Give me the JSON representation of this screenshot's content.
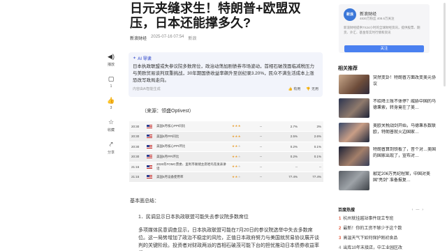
{
  "article": {
    "title": "日元夹缝求生！特朗普+欧盟双压，日本还能撑多久?",
    "source": "新浪财经",
    "datetime": "2025-07-16 07:54",
    "author_tag": "新浪"
  },
  "actions": [
    {
      "icon": "speaker-icon",
      "glyph": "◀)",
      "label": "播放"
    },
    {
      "icon": "comment-icon",
      "glyph": "▢",
      "label": "1"
    },
    {
      "icon": "thumb-up-icon",
      "glyph": "👍",
      "label": "3"
    },
    {
      "icon": "star-icon",
      "glyph": "☆",
      "label": "收藏"
    },
    {
      "icon": "share-icon",
      "glyph": "⤤",
      "label": "分享"
    }
  ],
  "ai_summary": {
    "label": "AI 导读",
    "text": "日本执政联盟或失参议院多数席位，政治动荡加剧债券市场波动，首相石破茂面临减税压力与美欧贸易谈判双重挑战，30年期国债收益率飙升至创纪录3.20%，民众不满生活成本上涨恐改写政局走向。",
    "footer": "内容由AI智能生成",
    "useful": "有用",
    "useless": "无用"
  },
  "source_line": "（来源：领盛Optivest）",
  "calendar": {
    "rows": [
      {
        "time": "20:30",
        "event": "美国6月核心PPI同比",
        "stars": 3,
        "prev": "--",
        "forecast": "2.7%",
        "actual": "3%"
      },
      {
        "time": "20:30",
        "event": "美国6月PPI同比",
        "stars": 3,
        "prev": "--",
        "forecast": "2.5%",
        "actual": "2.6%"
      },
      {
        "time": "20:30",
        "event": "美国6月核心PPI环比",
        "stars": 2,
        "prev": "--",
        "forecast": "0.2%",
        "actual": "0.1%"
      },
      {
        "time": "20:30",
        "event": "美国6月PPI环比",
        "stars": 2,
        "prev": "--",
        "forecast": "0.2%",
        "actual": "0.1%"
      },
      {
        "time": "21:15",
        "event": "2026年FOMC票委、里利市联储主席哈玛克发表讲话",
        "stars": 2,
        "prev": "--",
        "forecast": "--",
        "actual": "--"
      },
      {
        "time": "21:15",
        "event": "美国6月设备使用率",
        "stars": 2,
        "prev": "--",
        "forecast": "77.4%",
        "actual": "77.4%"
      }
    ]
  },
  "body": {
    "p1": "基本面总结：",
    "p2": "1．民调显示日本执政联盟可能失去参议院多数席位",
    "p3": "多项媒体民意调查显示，日本执政联盟可能在7月20日的参议院选举中失去多数席位。这一局势增加了政治不稳定的风险，正值日本政府努力与美国就贸易协议展开谈判的关键阶段。投资者对财政两派的首相石破茂可能下台的担忧推动日本债券收益率飙"
  },
  "account": {
    "logo_text": "新浪",
    "name": "新浪财经",
    "stats": "4830万粉丝 408.6万关注",
    "desc": "新浪财经提供7X24小时的全球财经资讯，提供股票、期货、外汇、基金等实时行情和资讯",
    "follow": "关注"
  },
  "related": {
    "title": "相关推荐",
    "items": [
      {
        "title": "突然变卦！特朗普方面改变美元协议"
      },
      {
        "title": "不给降土账不体停？威胁中国的马德秉索，转身竟在了美…"
      },
      {
        "title": "美欧关税战剑开始，马德秉系数联欧，特朗普就火边国家…"
      },
      {
        "title": "特朗普算到铁板了，昔个对…美国的国家出现了，宣布对…"
      },
      {
        "title": "敲定206万亮纪程案，中国对美国\"亮剑\" 准备报复…"
      }
    ]
  },
  "hot": {
    "title": "百度热搜",
    "refresh": "换一换",
    "items": [
      {
        "n": "1",
        "text": "杭州就挂越站事件现立专班"
      },
      {
        "n": "2",
        "text": "最新！你的工资不够少于这个数"
      },
      {
        "n": "3",
        "text": "高温天气下如何保护刚初食品"
      },
      {
        "n": "4",
        "text": "出库10年末接店，中工业园区改"
      }
    ]
  },
  "colors": {
    "accent": "#4a80f0",
    "ai": "#6476d8",
    "hot_red": "#e35a3c"
  }
}
